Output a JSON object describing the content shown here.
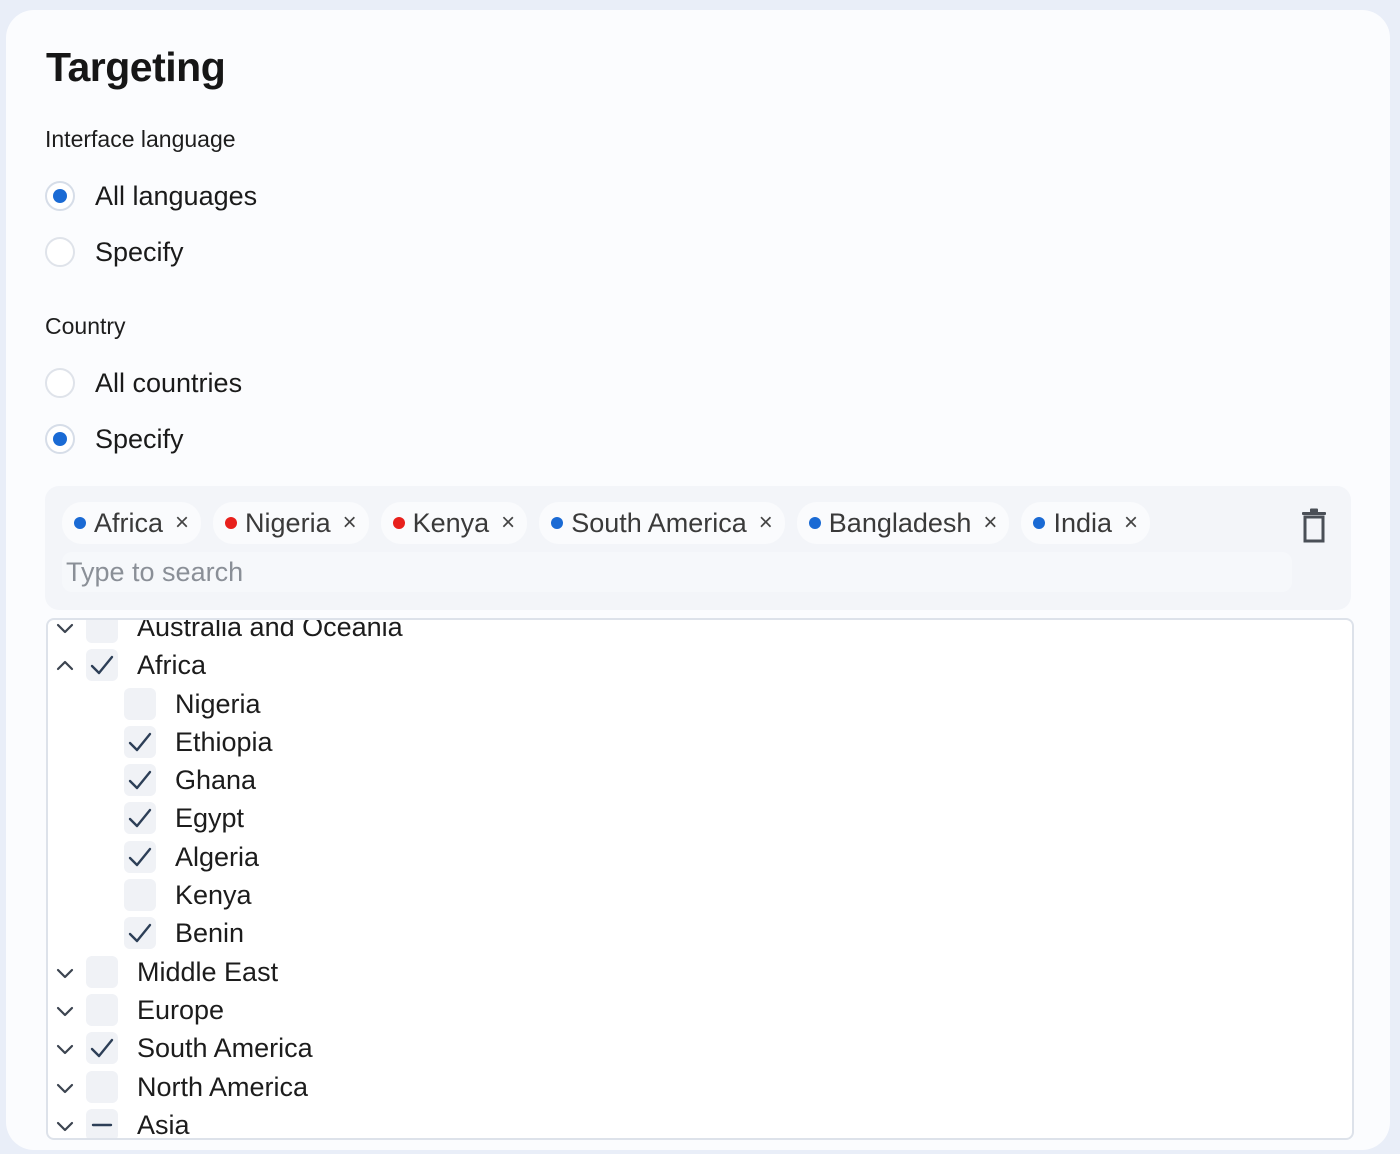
{
  "title": "Targeting",
  "interface_language": {
    "label": "Interface language",
    "options": [
      {
        "label": "All languages",
        "selected": true
      },
      {
        "label": "Specify",
        "selected": false
      }
    ]
  },
  "country": {
    "label": "Country",
    "options": [
      {
        "label": "All countries",
        "selected": false
      },
      {
        "label": "Specify",
        "selected": true
      }
    ]
  },
  "tags": [
    {
      "label": "Africa",
      "dot_color": "#1a6ad4"
    },
    {
      "label": "Nigeria",
      "dot_color": "#e8201c"
    },
    {
      "label": "Kenya",
      "dot_color": "#e8201c"
    },
    {
      "label": "South America",
      "dot_color": "#1a6ad4"
    },
    {
      "label": "Bangladesh",
      "dot_color": "#1a6ad4"
    },
    {
      "label": "India",
      "dot_color": "#1a6ad4"
    }
  ],
  "tag_remove_glyph": "×",
  "search": {
    "placeholder": "Type to search",
    "value": ""
  },
  "tree": [
    {
      "label": "Australia and Oceania",
      "level": 0,
      "state": "unchecked",
      "expand": "collapsed"
    },
    {
      "label": "Africa",
      "level": 0,
      "state": "checked",
      "expand": "expanded"
    },
    {
      "label": "Nigeria",
      "level": 1,
      "state": "unchecked"
    },
    {
      "label": "Ethiopia",
      "level": 1,
      "state": "checked"
    },
    {
      "label": "Ghana",
      "level": 1,
      "state": "checked"
    },
    {
      "label": "Egypt",
      "level": 1,
      "state": "checked"
    },
    {
      "label": "Algeria",
      "level": 1,
      "state": "checked"
    },
    {
      "label": "Kenya",
      "level": 1,
      "state": "unchecked"
    },
    {
      "label": "Benin",
      "level": 1,
      "state": "checked"
    },
    {
      "label": "Middle East",
      "level": 0,
      "state": "unchecked",
      "expand": "collapsed"
    },
    {
      "label": "Europe",
      "level": 0,
      "state": "unchecked",
      "expand": "collapsed"
    },
    {
      "label": "South America",
      "level": 0,
      "state": "checked",
      "expand": "collapsed"
    },
    {
      "label": "North America",
      "level": 0,
      "state": "unchecked",
      "expand": "collapsed"
    },
    {
      "label": "Asia",
      "level": 0,
      "state": "indeterminate",
      "expand": "collapsed"
    }
  ],
  "colors": {
    "accent": "#1a6ad4",
    "red": "#e8201c",
    "checkmark": "#2d3f57"
  }
}
